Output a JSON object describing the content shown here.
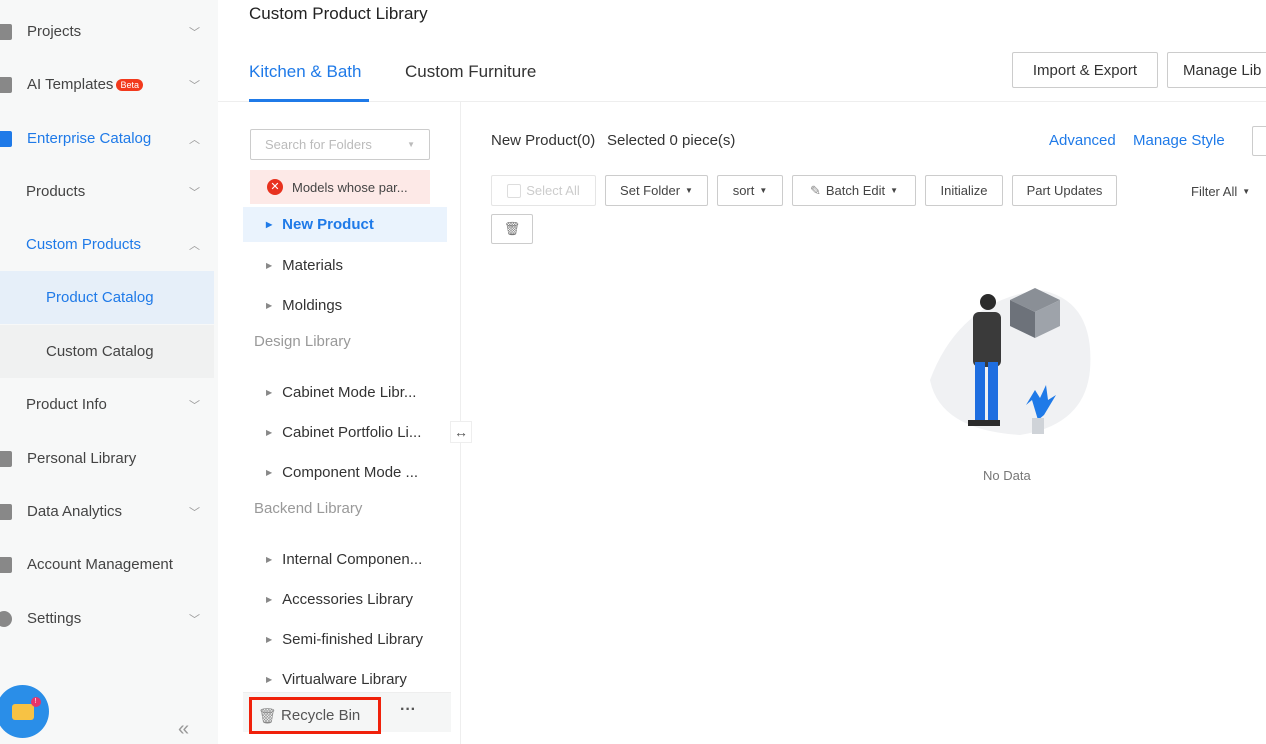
{
  "sidebar": {
    "items": [
      {
        "label": "Projects",
        "chevron": "v"
      },
      {
        "label": "AI Templates",
        "badge": "Beta",
        "chevron": "v"
      },
      {
        "label": "Enterprise Catalog",
        "chevron": "^"
      },
      {
        "label": "Products",
        "chevron": "v"
      },
      {
        "label": "Custom Products",
        "chevron": "^"
      },
      {
        "label": "Product Catalog"
      },
      {
        "label": "Custom Catalog"
      },
      {
        "label": "Product Info",
        "chevron": "v"
      },
      {
        "label": "Personal Library"
      },
      {
        "label": "Data Analytics",
        "chevron": "v"
      },
      {
        "label": "Account Management"
      },
      {
        "label": "Settings",
        "chevron": "v"
      }
    ],
    "collapse": "«",
    "chat_badge": "!"
  },
  "header": {
    "title": "Custom Product Library",
    "tabs": [
      "Kitchen & Bath",
      "Custom Furniture"
    ],
    "import_export": "Import & Export",
    "manage_lib": "Manage Lib"
  },
  "folders": {
    "search_placeholder": "Search for Folders",
    "error": "Models whose par...",
    "items": [
      "New Product",
      "Materials",
      "Moldings"
    ],
    "design_header": "Design Library",
    "design_items": [
      "Cabinet Mode Libr...",
      "Cabinet Portfolio Li...",
      "Component Mode ..."
    ],
    "backend_header": "Backend Library",
    "backend_items": [
      "Internal Componen...",
      "Accessories Library",
      "Semi-finished Library",
      "Virtualware Library"
    ],
    "recycle_bin": "Recycle Bin",
    "more": "···"
  },
  "main": {
    "count": "New Product(0)",
    "selected": "Selected 0 piece(s)",
    "advanced": "Advanced",
    "manage_style": "Manage Style",
    "select_all": "Select All",
    "set_folder": "Set Folder",
    "sort": "sort",
    "batch_edit": "Batch Edit",
    "initialize": "Initialize",
    "part_updates": "Part Updates",
    "filter_all": "Filter All",
    "empty": "No Data"
  }
}
